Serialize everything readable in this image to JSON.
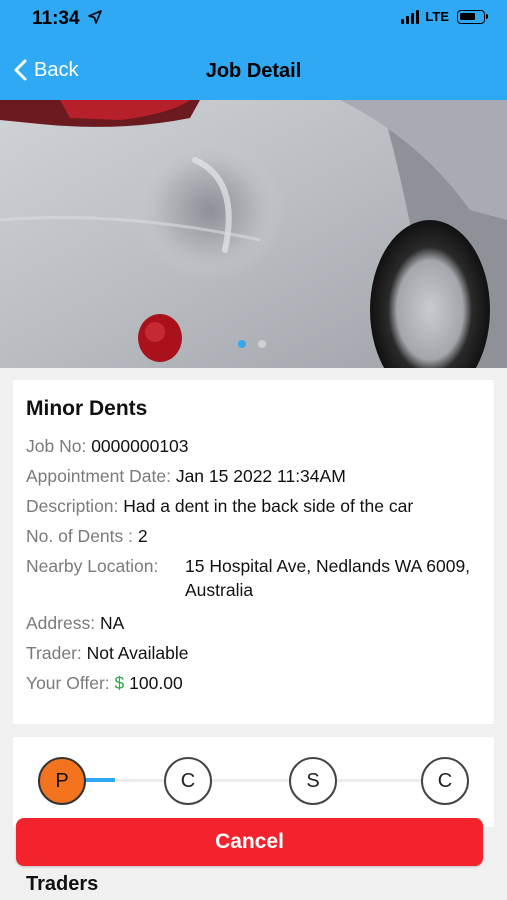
{
  "status_bar": {
    "time": "11:34",
    "network": "LTE"
  },
  "nav": {
    "back_label": "Back",
    "title": "Job Detail"
  },
  "carousel": {
    "page_count": 2,
    "active_index": 0
  },
  "job": {
    "title": "Minor Dents",
    "job_no_label": "Job No:",
    "job_no": "0000000103",
    "appointment_label": "Appointment Date:",
    "appointment_date": "Jan 15 2022 11:34AM",
    "description_label": "Description:",
    "description": "Had a dent in the back side of the car",
    "dents_label": "No. of Dents :",
    "dents": "2",
    "location_label": "Nearby Location:",
    "location": "15 Hospital Ave, Nedlands WA 6009, Australia",
    "address_label": "Address:",
    "address": "NA",
    "trader_label": "Trader:",
    "trader": "Not Available",
    "offer_label": "Your Offer:",
    "offer_currency": "$",
    "offer_amount": "100.00"
  },
  "progress": {
    "steps": [
      {
        "letter": "P",
        "active": true
      },
      {
        "letter": "C",
        "active": false
      },
      {
        "letter": "S",
        "active": false
      },
      {
        "letter": "C",
        "active": false
      }
    ],
    "progress_fraction": 0.1
  },
  "actions": {
    "cancel_label": "Cancel"
  },
  "traders": {
    "heading": "Traders"
  },
  "colors": {
    "primary": "#2fa9f4",
    "danger": "#f2232d",
    "active_step": "#f4731f",
    "money": "#2ca845"
  }
}
